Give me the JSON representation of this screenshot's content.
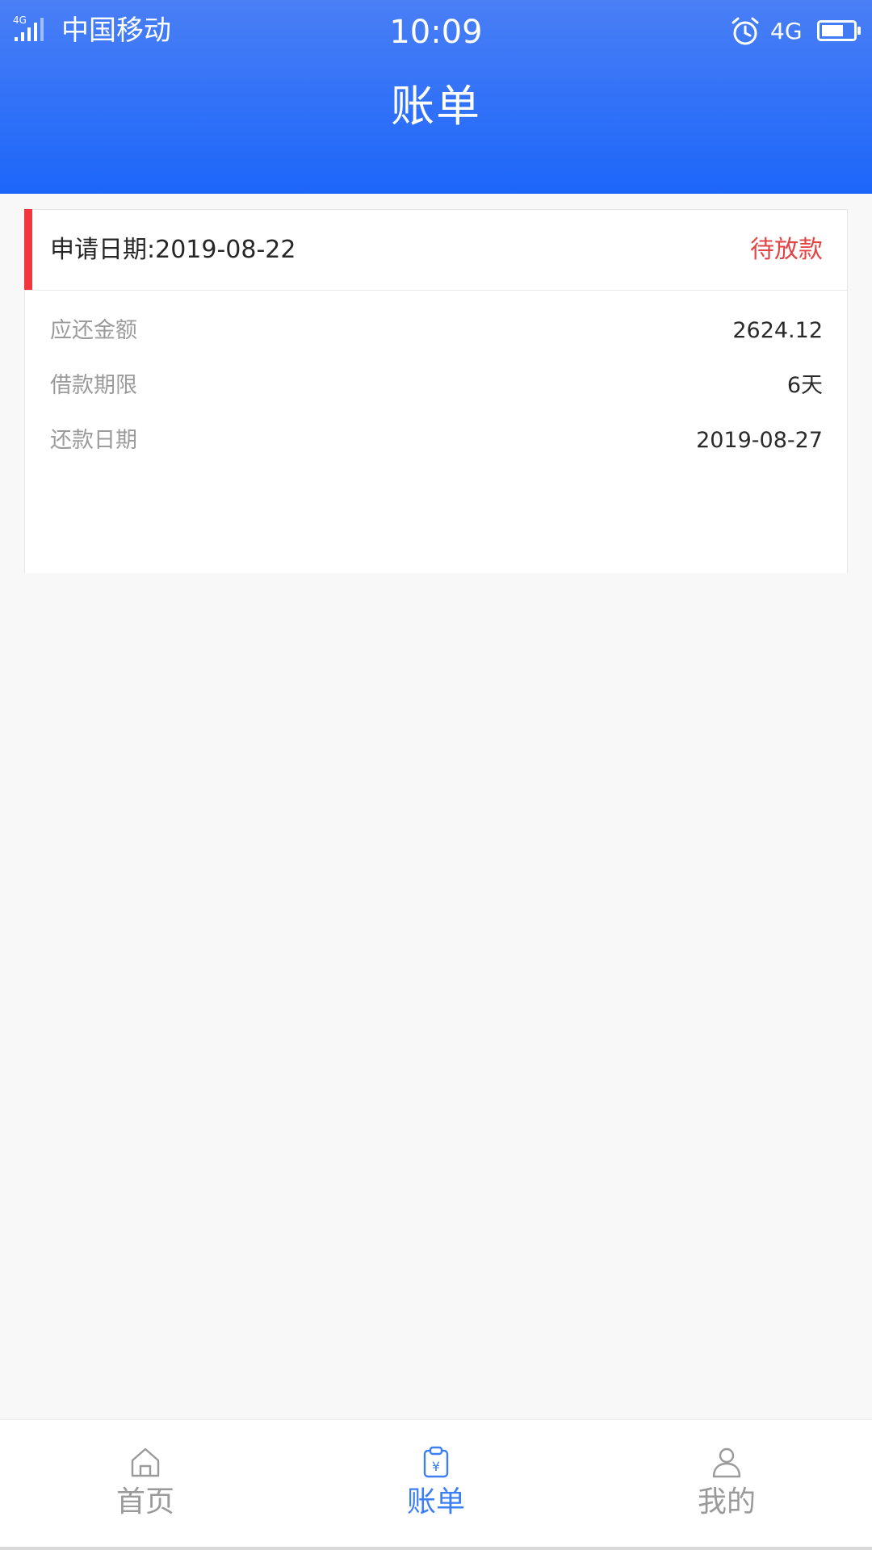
{
  "status_bar": {
    "signal_tag": "4G",
    "carrier": "中国移动",
    "time": "10:09",
    "network": "4G",
    "icons": [
      "signal-icon",
      "alarm-icon",
      "battery-icon"
    ]
  },
  "header": {
    "title": "账单",
    "gradient": [
      "#4a7ff6",
      "#1c66f9"
    ]
  },
  "bill": {
    "apply_date": "申请日期:2019-08-22",
    "status": "待放款",
    "accent_color": "#f2363d",
    "status_color": "#e34545",
    "rows": [
      {
        "label": "应还金额",
        "value": "2624.12"
      },
      {
        "label": "借款期限",
        "value": "6天"
      },
      {
        "label": "还款日期",
        "value": "2019-08-27"
      }
    ]
  },
  "tabbar": {
    "active_color": "#3c7ef4",
    "items": [
      {
        "label": "首页",
        "icon": "home-icon",
        "active": false
      },
      {
        "label": "账单",
        "icon": "bill-icon",
        "active": true
      },
      {
        "label": "我的",
        "icon": "user-icon",
        "active": false
      }
    ]
  }
}
